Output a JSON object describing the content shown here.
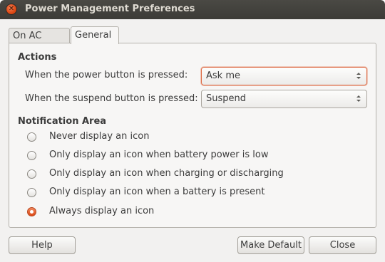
{
  "window": {
    "title": "Power Management Preferences"
  },
  "tabs": [
    {
      "label": "On AC Power",
      "active": false
    },
    {
      "label": "General",
      "active": true
    }
  ],
  "actions": {
    "heading": "Actions",
    "power_button": {
      "label": "When the power button is pressed:",
      "value": "Ask me"
    },
    "suspend_button": {
      "label": "When the suspend button is pressed:",
      "value": "Suspend"
    }
  },
  "notification": {
    "heading": "Notification Area",
    "options": [
      {
        "label": "Never display an icon",
        "checked": false
      },
      {
        "label": "Only display an icon when battery power is low",
        "checked": false
      },
      {
        "label": "Only display an icon when charging or discharging",
        "checked": false
      },
      {
        "label": "Only display an icon when a battery is present",
        "checked": false
      },
      {
        "label": "Always display an icon",
        "checked": true
      }
    ]
  },
  "buttons": {
    "help": "Help",
    "make_default": "Make Default",
    "close": "Close"
  },
  "colors": {
    "accent": "#dd4814",
    "titlebar": "#3c3b37",
    "window_bg": "#f2f1f0"
  }
}
